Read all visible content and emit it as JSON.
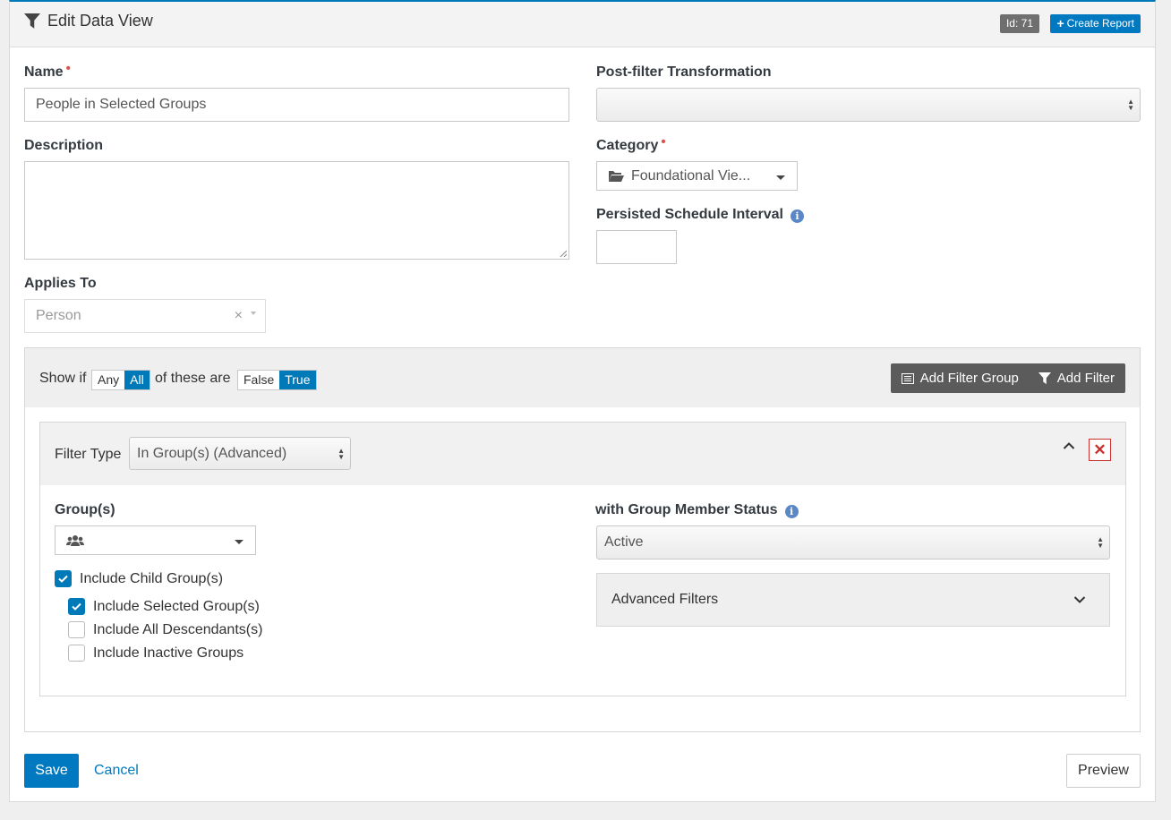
{
  "header": {
    "title": "Edit Data View",
    "id_badge": "Id: 71",
    "create_report_label": "Create Report"
  },
  "form": {
    "name_label": "Name",
    "name_value": "People in Selected Groups",
    "description_label": "Description",
    "description_value": "",
    "applies_to_label": "Applies To",
    "applies_to_value": "Person",
    "post_filter_label": "Post-filter Transformation",
    "post_filter_value": "",
    "category_label": "Category",
    "category_value": "Foundational Vie...",
    "persisted_label": "Persisted Schedule Interval",
    "persisted_value": ""
  },
  "filter_bar": {
    "show_if": "Show if",
    "any": "Any",
    "all": "All",
    "of_these_are": "of these are",
    "false": "False",
    "true": "True",
    "selected_match": "All",
    "selected_truth": "True",
    "add_filter_group": "Add Filter Group",
    "add_filter": "Add Filter"
  },
  "filter": {
    "type_label": "Filter Type",
    "type_value": "In Group(s) (Advanced)",
    "groups_label": "Group(s)",
    "status_label": "with Group Member Status",
    "status_value": "Active",
    "advanced_filters": "Advanced Filters",
    "checkboxes": [
      {
        "label": "Include Child Group(s)",
        "checked": true
      },
      {
        "label": "Include Selected Group(s)",
        "checked": true
      },
      {
        "label": "Include All Descendants(s)",
        "checked": false
      },
      {
        "label": "Include Inactive Groups",
        "checked": false
      }
    ]
  },
  "actions": {
    "save": "Save",
    "cancel": "Cancel",
    "preview": "Preview"
  },
  "colors": {
    "primary": "#0079c1",
    "danger": "#c9302c"
  }
}
